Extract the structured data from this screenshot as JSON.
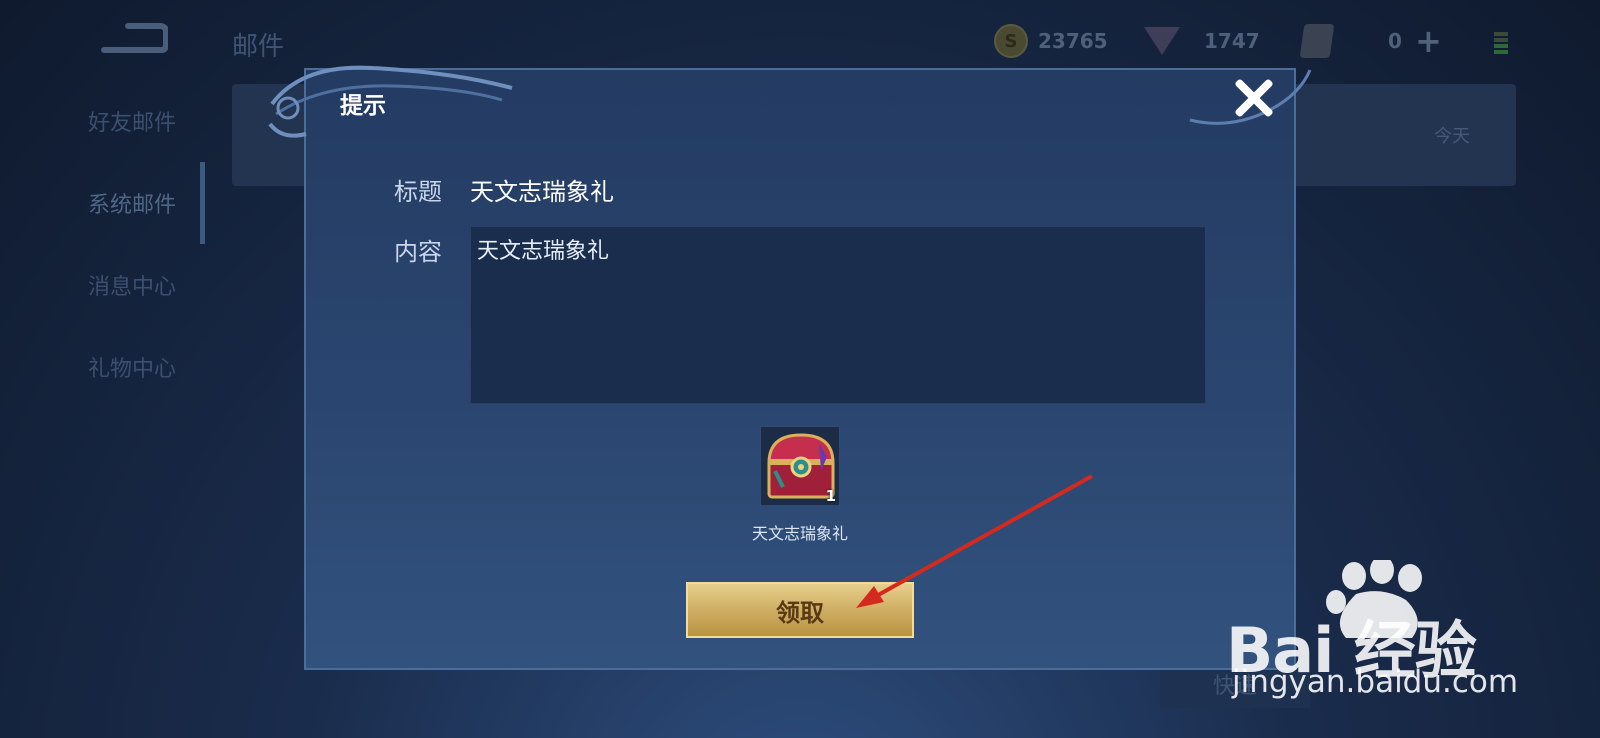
{
  "header": {
    "title": "邮件",
    "gold": "23765",
    "gems": "1747",
    "tickets": "0"
  },
  "sidebar": {
    "items": [
      {
        "label": "好友邮件"
      },
      {
        "label": "系统邮件"
      },
      {
        "label": "消息中心"
      },
      {
        "label": "礼物中心"
      }
    ]
  },
  "mail_list": {
    "date": "今天"
  },
  "quick_claim": "快速",
  "dialog": {
    "title": "提示",
    "subject_label": "标题",
    "subject": "天文志瑞象礼",
    "content_label": "内容",
    "content": "天文志瑞象礼",
    "item": {
      "name": "天文志瑞象礼",
      "count": "1",
      "icon": "treasure-chest-icon"
    },
    "claim_label": "领取"
  },
  "watermark": {
    "brand": "Bai  经验",
    "url": "jingyan.baidu.com"
  },
  "colors": {
    "dialog_bg": "#2a4670",
    "claim_gold": "#cfae63",
    "annotation_arrow": "#d42a1e"
  }
}
